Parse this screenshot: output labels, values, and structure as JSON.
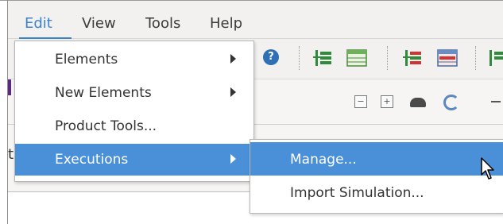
{
  "menubar": {
    "items": [
      {
        "label": "Edit"
      },
      {
        "label": "View"
      },
      {
        "label": "Tools"
      },
      {
        "label": "Help"
      }
    ],
    "active_item": "Edit",
    "accent": "#3b83cf"
  },
  "toolbar": {
    "icons": [
      "help-icon",
      "tree-expand-icon",
      "table-icon",
      "tree-collapse-icon",
      "table-edit-icon"
    ]
  },
  "edit_menu": {
    "items": [
      {
        "label": "Elements",
        "has_submenu": true
      },
      {
        "label": "New Elements",
        "has_submenu": true
      },
      {
        "label": "Product Tools...",
        "has_submenu": false
      },
      {
        "label": "Executions",
        "has_submenu": true,
        "highlighted": true
      }
    ],
    "highlight_color": "#4a90d9"
  },
  "executions_submenu": {
    "items": [
      {
        "label": "Manage...",
        "highlighted": true
      },
      {
        "label": "Import Simulation..."
      }
    ]
  }
}
